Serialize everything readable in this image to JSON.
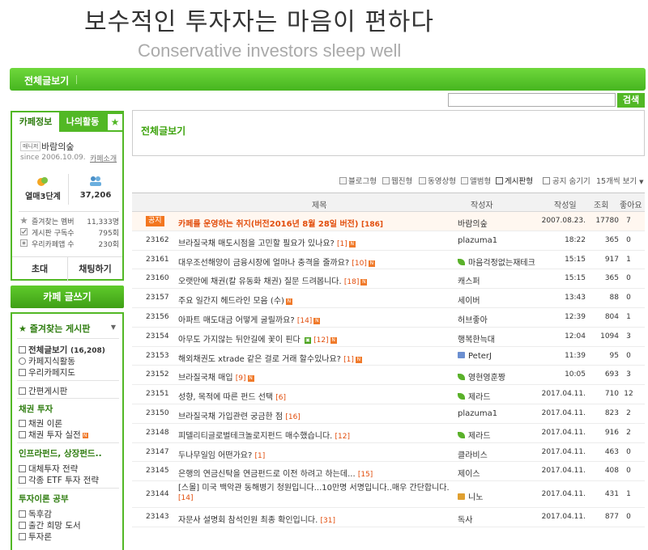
{
  "header": {
    "title": "보수적인 투자자는 마음이 편하다",
    "subtitle": "Conservative investors sleep well"
  },
  "menubar": {
    "all_posts": "전체글보기"
  },
  "search": {
    "button": "검색",
    "placeholder": ""
  },
  "sidebar": {
    "tabs": {
      "cafe_info": "카페정보",
      "my_activity": "나의활동",
      "star": "★"
    },
    "manager_tag": "매니저",
    "manager_name": "바람의숲",
    "since": "since 2006.10.09.",
    "cafe_intro": "카페소개",
    "level": "열매3단계",
    "members": "37,206",
    "stats": [
      {
        "label": "즐겨찾는 멤버",
        "value": "11,333명"
      },
      {
        "label": "게시판 구독수",
        "value": "795회"
      },
      {
        "label": "우리카페앱 수",
        "value": "230회"
      }
    ],
    "invite": "초대",
    "chat": "채팅하기",
    "write": "카페 글쓰기",
    "fav_header": "즐겨찾는 게시판",
    "boards": {
      "all": "전체글보기",
      "all_count": "(16,208)",
      "cafe_knowledge": "카페지식활동",
      "cafe_map": "우리카페지도",
      "short": "간편게시판",
      "bond_header": "채권 투자",
      "bond_theory": "채권 이론",
      "bond_practice": "채권 투자 실전",
      "infra_header": "인프라펀드, 상장펀드..",
      "alt_strategy": "대체투자 전략",
      "etf_strategy": "각종 ETF 투자 전략",
      "theory_header": "투자이론 공부",
      "reading": "독후감",
      "wish_books": "출간 희망 도서",
      "discussion": "투자론",
      "new_badge": "N"
    }
  },
  "main": {
    "title": "전체글보기",
    "toolbar": {
      "blog": "블로그형",
      "web": "웹진형",
      "video": "동영상형",
      "album": "앨범형",
      "board": "게시판형",
      "hide_notice": "공지 숨기기",
      "per_page": "15개씩 보기"
    },
    "columns": {
      "title": "제목",
      "author": "작성자",
      "date": "작성일",
      "views": "조회",
      "likes": "좋아요"
    },
    "rows": [
      {
        "no": "공지",
        "title": "카페를 운영하는 취지(버전2016년 8월 28일 버전)",
        "cmt": "[186]",
        "author": "바람의숲",
        "date": "2007.08.23.",
        "views": "17780",
        "likes": "7"
      },
      {
        "no": "23162",
        "title": "브라질국채 매도시점을 고민할 필요가 있나요?",
        "cmt": "[1]",
        "author": "plazuma1",
        "date": "18:22",
        "views": "365",
        "likes": "0"
      },
      {
        "no": "23161",
        "title": "대우조선해양이 금융시장에 얼마나 충격을 줄까요?",
        "cmt": "[10]",
        "author": "마음걱정없는재테크",
        "date": "15:15",
        "views": "917",
        "likes": "1"
      },
      {
        "no": "23160",
        "title": "오랫만에 채권(칼 유동화 채권) 질문 드려봅니다.",
        "cmt": "[18]",
        "author": "캐스퍼",
        "date": "15:15",
        "views": "365",
        "likes": "0"
      },
      {
        "no": "23157",
        "title": "주요 일간지 헤드라인 모음 (수)",
        "cmt": "",
        "author": "세이버",
        "date": "13:43",
        "views": "88",
        "likes": "0"
      },
      {
        "no": "23156",
        "title": "아파트 매도대금 어떻게 굴릴까요?",
        "cmt": "[14]",
        "author": "허브좋아",
        "date": "12:39",
        "views": "804",
        "likes": "1"
      },
      {
        "no": "23154",
        "title": "아무도 가지않는 뒤안길에 꽃이 핀다",
        "cmt": "[12]",
        "author": "행복한늑대",
        "date": "12:04",
        "views": "1094",
        "likes": "3"
      },
      {
        "no": "23153",
        "title": "해외채권도 xtrade 같은 걸로 거래 할수있나요?",
        "cmt": "[1]",
        "author": "PeterJ",
        "date": "11:39",
        "views": "95",
        "likes": "0"
      },
      {
        "no": "23152",
        "title": "브라질국채 매입",
        "cmt": "[9]",
        "author": "영현영훈짱",
        "date": "10:05",
        "views": "693",
        "likes": "3"
      },
      {
        "no": "23151",
        "title": "성향, 목적에 따른 펀드 선택",
        "cmt": "[6]",
        "author": "제라드",
        "date": "2017.04.11.",
        "views": "710",
        "likes": "12"
      },
      {
        "no": "23150",
        "title": "브라질국채 가입관련 궁금한 점",
        "cmt": "[16]",
        "author": "plazuma1",
        "date": "2017.04.11.",
        "views": "823",
        "likes": "2"
      },
      {
        "no": "23148",
        "title": "피델리티글로벌테크놀로지펀드 매수했습니다.",
        "cmt": "[12]",
        "author": "제라드",
        "date": "2017.04.11.",
        "views": "916",
        "likes": "2"
      },
      {
        "no": "23147",
        "title": "두나무일임 어떤가요?",
        "cmt": "[1]",
        "author": "클라비스",
        "date": "2017.04.11.",
        "views": "463",
        "likes": "0"
      },
      {
        "no": "23145",
        "title": "은행의 연금신탁을 연금펀드로 이전 하려고 하는데...",
        "cmt": "[15]",
        "author": "제이스",
        "date": "2017.04.11.",
        "views": "408",
        "likes": "0"
      },
      {
        "no": "23144",
        "title": "[스몰] 미국 백악관 동해병기 청원입니다...10만명 서명입니다..매우 간단합니다.",
        "cmt": "[14]",
        "author": "니노",
        "date": "2017.04.11.",
        "views": "431",
        "likes": "1"
      },
      {
        "no": "23143",
        "title": "자문사 설명회 참석인원 최종 확인입니다.",
        "cmt": "[31]",
        "author": "독사",
        "date": "2017.04.11.",
        "views": "877",
        "likes": "0"
      }
    ]
  },
  "colors": {
    "green": "#52b825",
    "dark_green": "#2f7d10",
    "orange": "#f3761f",
    "comment": "#e24d0b"
  }
}
